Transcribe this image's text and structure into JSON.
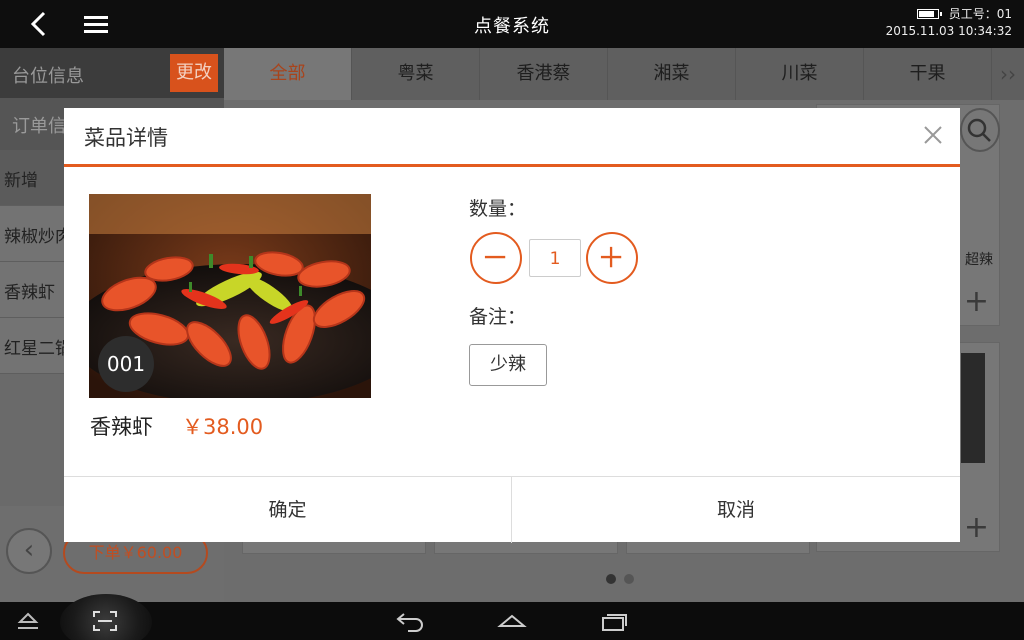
{
  "header": {
    "title": "点餐系统",
    "employee": "员工号：01",
    "datetime": "2015.11.03 10:34:32",
    "battery_level": 0.85
  },
  "left_panel": {
    "table_info_label": "台位信息",
    "change_label": "更改",
    "order_info_label": "订单信",
    "rows": [
      "新增",
      "辣椒炒肉",
      "香辣虾",
      "红星二锅"
    ],
    "submit_label": "下单￥60.00",
    "prev_icon": "chevron-left-icon"
  },
  "tabs": [
    "全部",
    "粤菜",
    "香港蔡",
    "湘菜",
    "川菜",
    "干果"
  ],
  "content": {
    "card_tag": "超辣",
    "page_indicator": {
      "pages": 2,
      "current": 1
    }
  },
  "dialog": {
    "title": "菜品详情",
    "number_badge": "001",
    "dish_name": "香辣虾",
    "price": "￥38.00",
    "quantity_label": "数量：",
    "quantity_value": "1",
    "note_label": "备注：",
    "note_tag": "少辣",
    "confirm_label": "确定",
    "cancel_label": "取消"
  },
  "colors": {
    "accent": "#e35b1f",
    "topbar": "#0e0e0e",
    "overlay_dim": "#6d6d6d"
  }
}
